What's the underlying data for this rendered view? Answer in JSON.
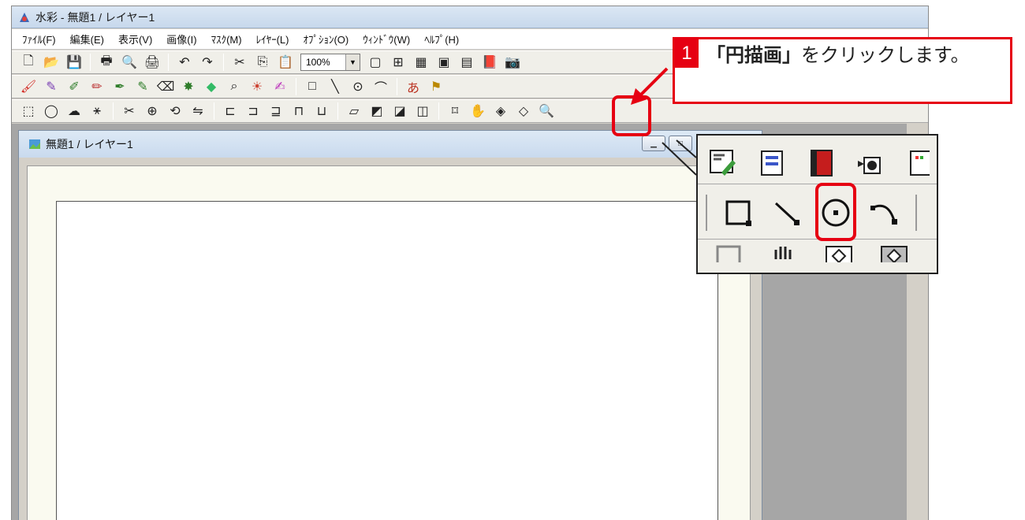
{
  "window": {
    "title": "水彩 - 無題1 / レイヤー1",
    "icon": "paint-app-icon"
  },
  "menu": [
    "ﾌｧｲﾙ(F)",
    "編集(E)",
    "表示(V)",
    "画像(I)",
    "ﾏｽｸ(M)",
    "ﾚｲﾔｰ(L)",
    "ｵﾌﾟｼｮﾝ(O)",
    "ｳｨﾝﾄﾞｳ(W)",
    "ﾍﾙﾌﾟ(H)"
  ],
  "toolbar_standard": {
    "zoom": "100%"
  },
  "document": {
    "title": "無題1 / レイヤー1"
  },
  "callout": {
    "number": "1",
    "bold": "「円描画」",
    "rest": "をクリックします。"
  },
  "colors": {
    "accent": "#e60012",
    "bar_blue": "#c7d8ec",
    "panel": "#f0efe9"
  }
}
